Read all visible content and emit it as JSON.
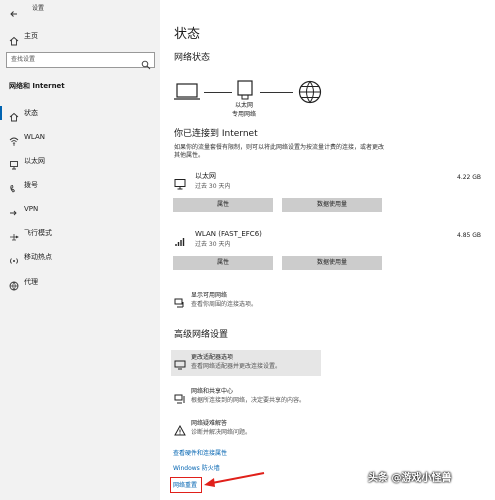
{
  "window": {
    "title": "设置"
  },
  "sidebar": {
    "home_label": "主页",
    "search_placeholder": "查找设置",
    "section_title": "网络和 Internet",
    "items": [
      {
        "label": "状态",
        "icon": "home-globe-icon",
        "active": true
      },
      {
        "label": "WLAN",
        "icon": "wifi-icon"
      },
      {
        "label": "以太网",
        "icon": "ethernet-icon"
      },
      {
        "label": "拨号",
        "icon": "dialup-icon"
      },
      {
        "label": "VPN",
        "icon": "vpn-icon"
      },
      {
        "label": "飞行模式",
        "icon": "airplane-icon"
      },
      {
        "label": "移动热点",
        "icon": "hotspot-icon"
      },
      {
        "label": "代理",
        "icon": "proxy-globe-icon"
      }
    ]
  },
  "main": {
    "page_title": "状态",
    "network_status_heading": "网络状态",
    "diagram": {
      "label_line1": "以太网",
      "label_line2": "专用网络"
    },
    "connected_heading": "你已连接到 Internet",
    "connected_desc": "如果你的流量套餐有限制，则可以将此网络设置为按流量计费的连接，或者更改其他属性。",
    "connections": [
      {
        "name": "以太网",
        "sub": "过去 30 天内",
        "usage": "4.22 GB",
        "btn_props": "属性",
        "btn_usage": "数据使用量"
      },
      {
        "name": "WLAN (FAST_EFC6)",
        "sub": "过去 30 天内",
        "usage": "4.85 GB",
        "btn_props": "属性",
        "btn_usage": "数据使用量"
      }
    ],
    "show_networks": {
      "title": "显示可用网络",
      "desc": "查看你周围的连接选项。"
    },
    "advanced_heading": "高级网络设置",
    "advanced_items": [
      {
        "title": "更改适配器选项",
        "desc": "查看网络适配器并更改连接设置。"
      },
      {
        "title": "网络和共享中心",
        "desc": "根据所连接到的网络，决定要共享的内容。"
      },
      {
        "title": "网络疑难解答",
        "desc": "诊断并解决网络问题。"
      }
    ],
    "links": {
      "hardware": "查看硬件和连接属性",
      "firewall": "Windows 防火墙",
      "reset": "网络重置"
    }
  },
  "watermark": "头条 @游戏小怪兽"
}
